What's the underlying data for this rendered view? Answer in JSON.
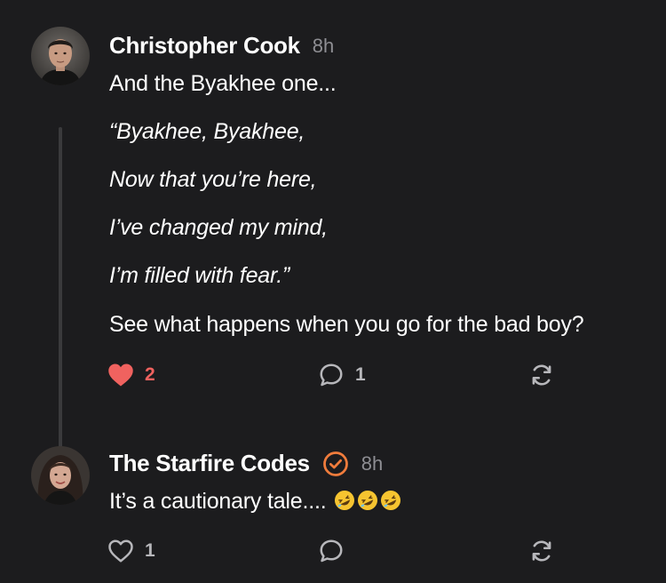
{
  "posts": [
    {
      "author": "Christopher Cook",
      "time": "8h",
      "lines": [
        "And the Byakhee one...",
        "“Byakhee, Byakhee,",
        "Now that you’re here,",
        "I’ve changed my mind,",
        "I’m filled with fear.”",
        "See what happens when you go for the bad boy?"
      ],
      "likes": "2",
      "liked": true,
      "replies": "1"
    },
    {
      "author": "The Starfire Codes",
      "verified": true,
      "time": "8h",
      "text": "It’s a cautionary tale....",
      "emojis": [
        "rolling-on-floor-laughing-emoji",
        "rolling-on-floor-laughing-emoji",
        "rolling-on-floor-laughing-emoji"
      ],
      "likes": "1",
      "liked": false,
      "replies": ""
    }
  ],
  "colors": {
    "background": "#1c1c1e",
    "like_active": "#f0625f",
    "verified_badge": "#f07c3c",
    "muted": "#8e8e93"
  }
}
